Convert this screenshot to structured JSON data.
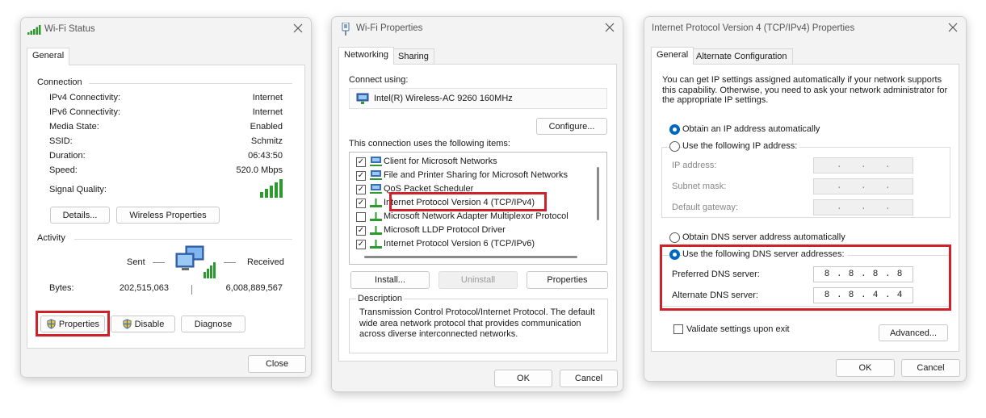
{
  "wifi_status": {
    "title": "Wi-Fi Status",
    "tab": "General",
    "connection_label": "Connection",
    "rows": [
      {
        "label": "IPv4 Connectivity:",
        "value": "Internet"
      },
      {
        "label": "IPv6 Connectivity:",
        "value": "Internet"
      },
      {
        "label": "Media State:",
        "value": "Enabled"
      },
      {
        "label": "SSID:",
        "value": "Schmitz"
      },
      {
        "label": "Duration:",
        "value": "06:43:50"
      },
      {
        "label": "Speed:",
        "value": "520.0 Mbps"
      }
    ],
    "signal_label": "Signal Quality:",
    "details_btn": "Details...",
    "wireless_props_btn": "Wireless Properties",
    "activity_label": "Activity",
    "sent_label": "Sent",
    "received_label": "Received",
    "bytes_label": "Bytes:",
    "bytes_sent": "202,515,063",
    "bytes_received": "6,008,889,567",
    "properties_btn": "Properties",
    "disable_btn": "Disable",
    "diagnose_btn": "Diagnose",
    "close_btn": "Close"
  },
  "wifi_properties": {
    "title": "Wi-Fi Properties",
    "tabs": [
      "Networking",
      "Sharing"
    ],
    "connect_using_label": "Connect using:",
    "adapter": "Intel(R) Wireless-AC 9260 160MHz",
    "configure_btn": "Configure...",
    "items_label": "This connection uses the following items:",
    "items": [
      {
        "label": "Client for Microsoft Networks",
        "checked": true
      },
      {
        "label": "File and Printer Sharing for Microsoft Networks",
        "checked": true
      },
      {
        "label": "QoS Packet Scheduler",
        "checked": true
      },
      {
        "label": "Internet Protocol Version 4 (TCP/IPv4)",
        "checked": true
      },
      {
        "label": "Microsoft Network Adapter Multiplexor Protocol",
        "checked": false
      },
      {
        "label": "Microsoft LLDP Protocol Driver",
        "checked": true
      },
      {
        "label": "Internet Protocol Version 6 (TCP/IPv6)",
        "checked": true
      }
    ],
    "install_btn": "Install...",
    "uninstall_btn": "Uninstall",
    "properties_btn": "Properties",
    "description_label": "Description",
    "description_text": "Transmission Control Protocol/Internet Protocol. The default wide area network protocol that provides communication across diverse interconnected networks.",
    "ok_btn": "OK",
    "cancel_btn": "Cancel"
  },
  "ipv4_properties": {
    "title": "Internet Protocol Version 4 (TCP/IPv4) Properties",
    "tabs": [
      "General",
      "Alternate Configuration"
    ],
    "info_text": "You can get IP settings assigned automatically if your network supports this capability. Otherwise, you need to ask your network administrator for the appropriate IP settings.",
    "obtain_ip_auto": "Obtain an IP address automatically",
    "use_following_ip": "Use the following IP address:",
    "ip_address_label": "IP address:",
    "subnet_mask_label": "Subnet mask:",
    "default_gateway_label": "Default gateway:",
    "obtain_dns_auto": "Obtain DNS server address automatically",
    "use_following_dns": "Use the following DNS server addresses:",
    "preferred_dns_label": "Preferred DNS server:",
    "preferred_dns": [
      "8",
      "8",
      "8",
      "8"
    ],
    "alternate_dns_label": "Alternate DNS server:",
    "alternate_dns": [
      "8",
      "8",
      "4",
      "4"
    ],
    "validate_label": "Validate settings upon exit",
    "advanced_btn": "Advanced...",
    "ok_btn": "OK",
    "cancel_btn": "Cancel"
  },
  "colors": {
    "highlight": "#d0202a",
    "radio_selected": "#0067c0",
    "window_bg": "#f3f3f3"
  }
}
